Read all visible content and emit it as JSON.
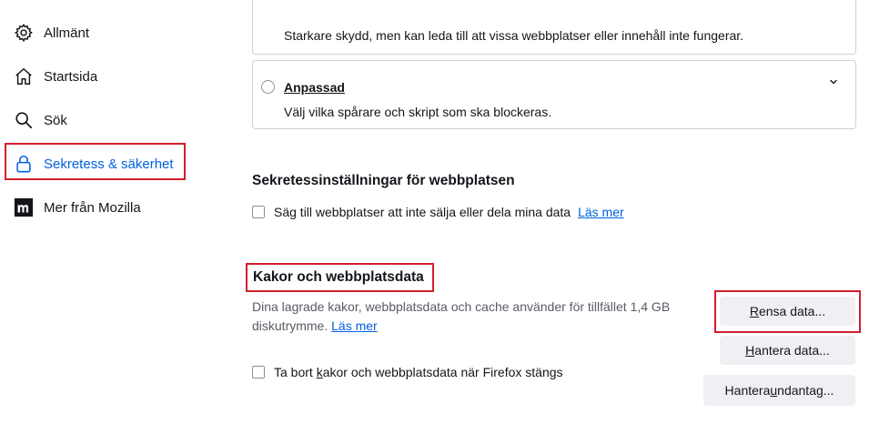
{
  "sidebar": {
    "items": [
      {
        "label": "Allmänt",
        "icon": "gear-icon"
      },
      {
        "label": "Startsida",
        "icon": "home-icon"
      },
      {
        "label": "Sök",
        "icon": "search-icon"
      },
      {
        "label": "Sekretess & säkerhet",
        "icon": "lock-icon",
        "selected": true
      },
      {
        "label": "Mer från Mozilla",
        "icon": "mozilla-logo-icon"
      }
    ]
  },
  "protection": {
    "strict_desc": "Starkare skydd, men kan leda till att vissa webbplatser eller innehåll inte fungerar.",
    "custom": {
      "title": "Anpassad",
      "desc": "Välj vilka spårare och skript som ska blockeras.",
      "selected": false
    }
  },
  "website_privacy": {
    "heading": "Sekretessinställningar för webbplatsen",
    "dnt_label": "Säg till webbplatser att inte sälja eller dela mina data",
    "dnt_checked": false,
    "learn_more": "Läs mer"
  },
  "cookies": {
    "heading": "Kakor och webbplatsdata",
    "desc": "Dina lagrade kakor, webbplatsdata och cache använder för tillfället 1,4 GB diskutrymme.",
    "learn_more": "Läs mer",
    "clear_button": {
      "pre": "",
      "u": "R",
      "post": "ensa data..."
    },
    "manage_button": {
      "pre": "",
      "u": "H",
      "post": "antera data..."
    },
    "exceptions_button": {
      "pre": "Hantera ",
      "u": "u",
      "post": "ndantag..."
    },
    "delete_on_close": {
      "pre": "Ta bort ",
      "u": "k",
      "post": "akor och webbplatsdata när Firefox stängs"
    },
    "delete_on_close_checked": false
  },
  "colors": {
    "accent": "#0061e0",
    "highlight": "#d31d2d",
    "button_bg": "#f0f0f4"
  }
}
